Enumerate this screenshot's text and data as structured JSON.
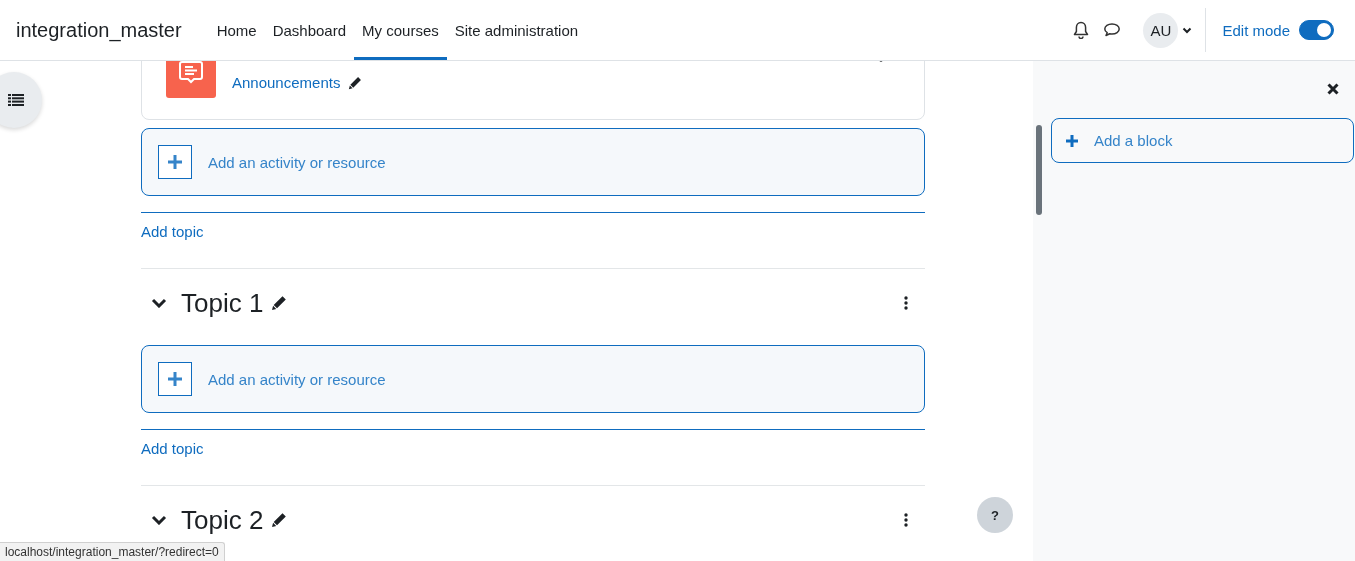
{
  "site_name": "integration_master",
  "nav": [
    {
      "label": "Home",
      "selected": false
    },
    {
      "label": "Dashboard",
      "selected": false
    },
    {
      "label": "My courses",
      "selected": true
    },
    {
      "label": "Site administration",
      "selected": false
    }
  ],
  "user": {
    "initials": "AU"
  },
  "edit_mode": {
    "label": "Edit mode",
    "on": true
  },
  "sections": [
    {
      "kind": "general",
      "activities": [
        {
          "kind": "forum",
          "name": "Announcements"
        }
      ],
      "add_activity": "Add an activity or resource",
      "add_topic": "Add topic"
    },
    {
      "kind": "topic",
      "title": "Topic 1",
      "expanded": true,
      "add_activity": "Add an activity or resource",
      "add_topic": "Add topic"
    },
    {
      "kind": "topic",
      "title": "Topic 2",
      "expanded": true
    }
  ],
  "drawer": {
    "add_block": "Add a block"
  },
  "help": "?",
  "status_bar": "localhost/integration_master/?redirect=0"
}
